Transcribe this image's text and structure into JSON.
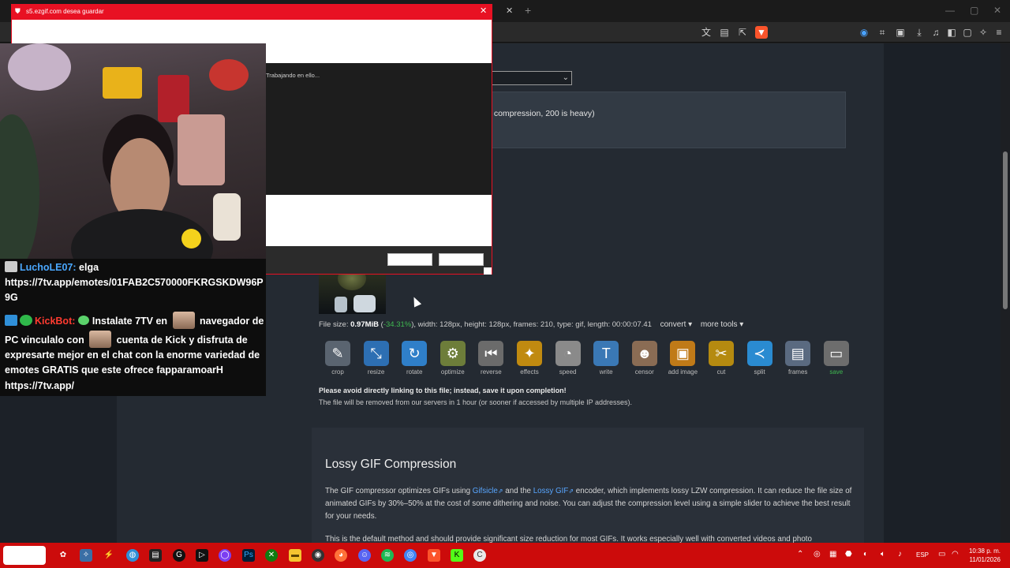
{
  "dialog": {
    "title": "s5.ezgif.com desea guardar",
    "close_glyph": "✕",
    "status": "Trabajando en ello..."
  },
  "browser": {
    "tab_close": "✕",
    "new_tab": "+",
    "win_min": "—",
    "win_max": "▢",
    "win_close": "✕"
  },
  "page": {
    "select_value": "",
    "hint_text": "t compression, 200 is heavy)",
    "fileinfo": {
      "label": "File size: ",
      "size": "0.97MiB",
      "pct_open": " (",
      "pct": "-34.31%",
      "rest": "), width: 128px, height: 128px, frames: 210, type: gif, length: 00:00:07.41",
      "convert": "convert ▾",
      "more_tools": "more tools ▾"
    },
    "tools": [
      {
        "label": "crop",
        "glyph": "✎",
        "color": "#5a6470"
      },
      {
        "label": "resize",
        "glyph": "⤡",
        "color": "#2d6fb3"
      },
      {
        "label": "rotate",
        "glyph": "↻",
        "color": "#2f7fc9"
      },
      {
        "label": "optimize",
        "glyph": "⚙",
        "color": "#6d7d3a"
      },
      {
        "label": "reverse",
        "glyph": "⏮",
        "color": "#6b6b6b"
      },
      {
        "label": "effects",
        "glyph": "✦",
        "color": "#c08a10"
      },
      {
        "label": "speed",
        "glyph": "◔",
        "color": "#8a8a8a"
      },
      {
        "label": "write",
        "glyph": "T",
        "color": "#3a78b5"
      },
      {
        "label": "censor",
        "glyph": "☻",
        "color": "#8a6c54"
      },
      {
        "label": "add image",
        "glyph": "▣",
        "color": "#c07a18"
      },
      {
        "label": "cut",
        "glyph": "✂",
        "color": "#b58a10"
      },
      {
        "label": "split",
        "glyph": "≺",
        "color": "#2a8bd1"
      },
      {
        "label": "frames",
        "glyph": "▤",
        "color": "#5a6a80"
      },
      {
        "label": "save",
        "glyph": "▭",
        "color": "#6d6d6d"
      }
    ],
    "warning_bold": "Please avoid directly linking to this file; instead, save it upon completion!",
    "warning_note": "The file will be removed from our servers in 1 hour (or sooner if accessed by multiple IP addresses).",
    "section_title": "Lossy GIF Compression",
    "section_p1_a": "The GIF compressor optimizes GIFs using ",
    "section_link1": "Gifsicle",
    "section_p1_b": " and the ",
    "section_link2": "Lossy GIF",
    "section_p1_c": " encoder, which implements lossy LZW compression. It can reduce the file size of animated GIFs by 30%–50% at the cost of some dithering and noise. You can adjust the compression level using a simple slider to achieve the best result for your needs.",
    "section_p2": "This is the default method and should provide significant size reduction for most GIFs. It works especially well with converted videos and photo"
  },
  "chat": {
    "msg1_user": "LuchoLE07:",
    "msg1_text": " elga",
    "msg1_link_a": "https://7tv.app/emotes/01FAB2C570000FKRGSKDW96P",
    "msg1_link_b": "9G",
    "msg2_user": "KickBot:",
    "msg2_a": " Instalate 7TV en ",
    "msg2_b": " navegador de",
    "msg2_c": "PC vinculalo con ",
    "msg2_d": " cuenta de Kick y disfruta de",
    "msg2_e": "expresarte mejor en el chat con la enorme variedad de",
    "msg2_f": "emotes GRATIS que este ofrece fapparamoarH",
    "msg2_link": "https://7tv.app/"
  },
  "taskbar": {
    "lang": "ESP",
    "time": "10:38 p. m.",
    "date": "11/01/2026"
  },
  "colors": {
    "dialog_accent": "#e81123",
    "taskbar": "#cc0b0b",
    "link": "#58a6ff",
    "savings_green": "#3fb950"
  }
}
